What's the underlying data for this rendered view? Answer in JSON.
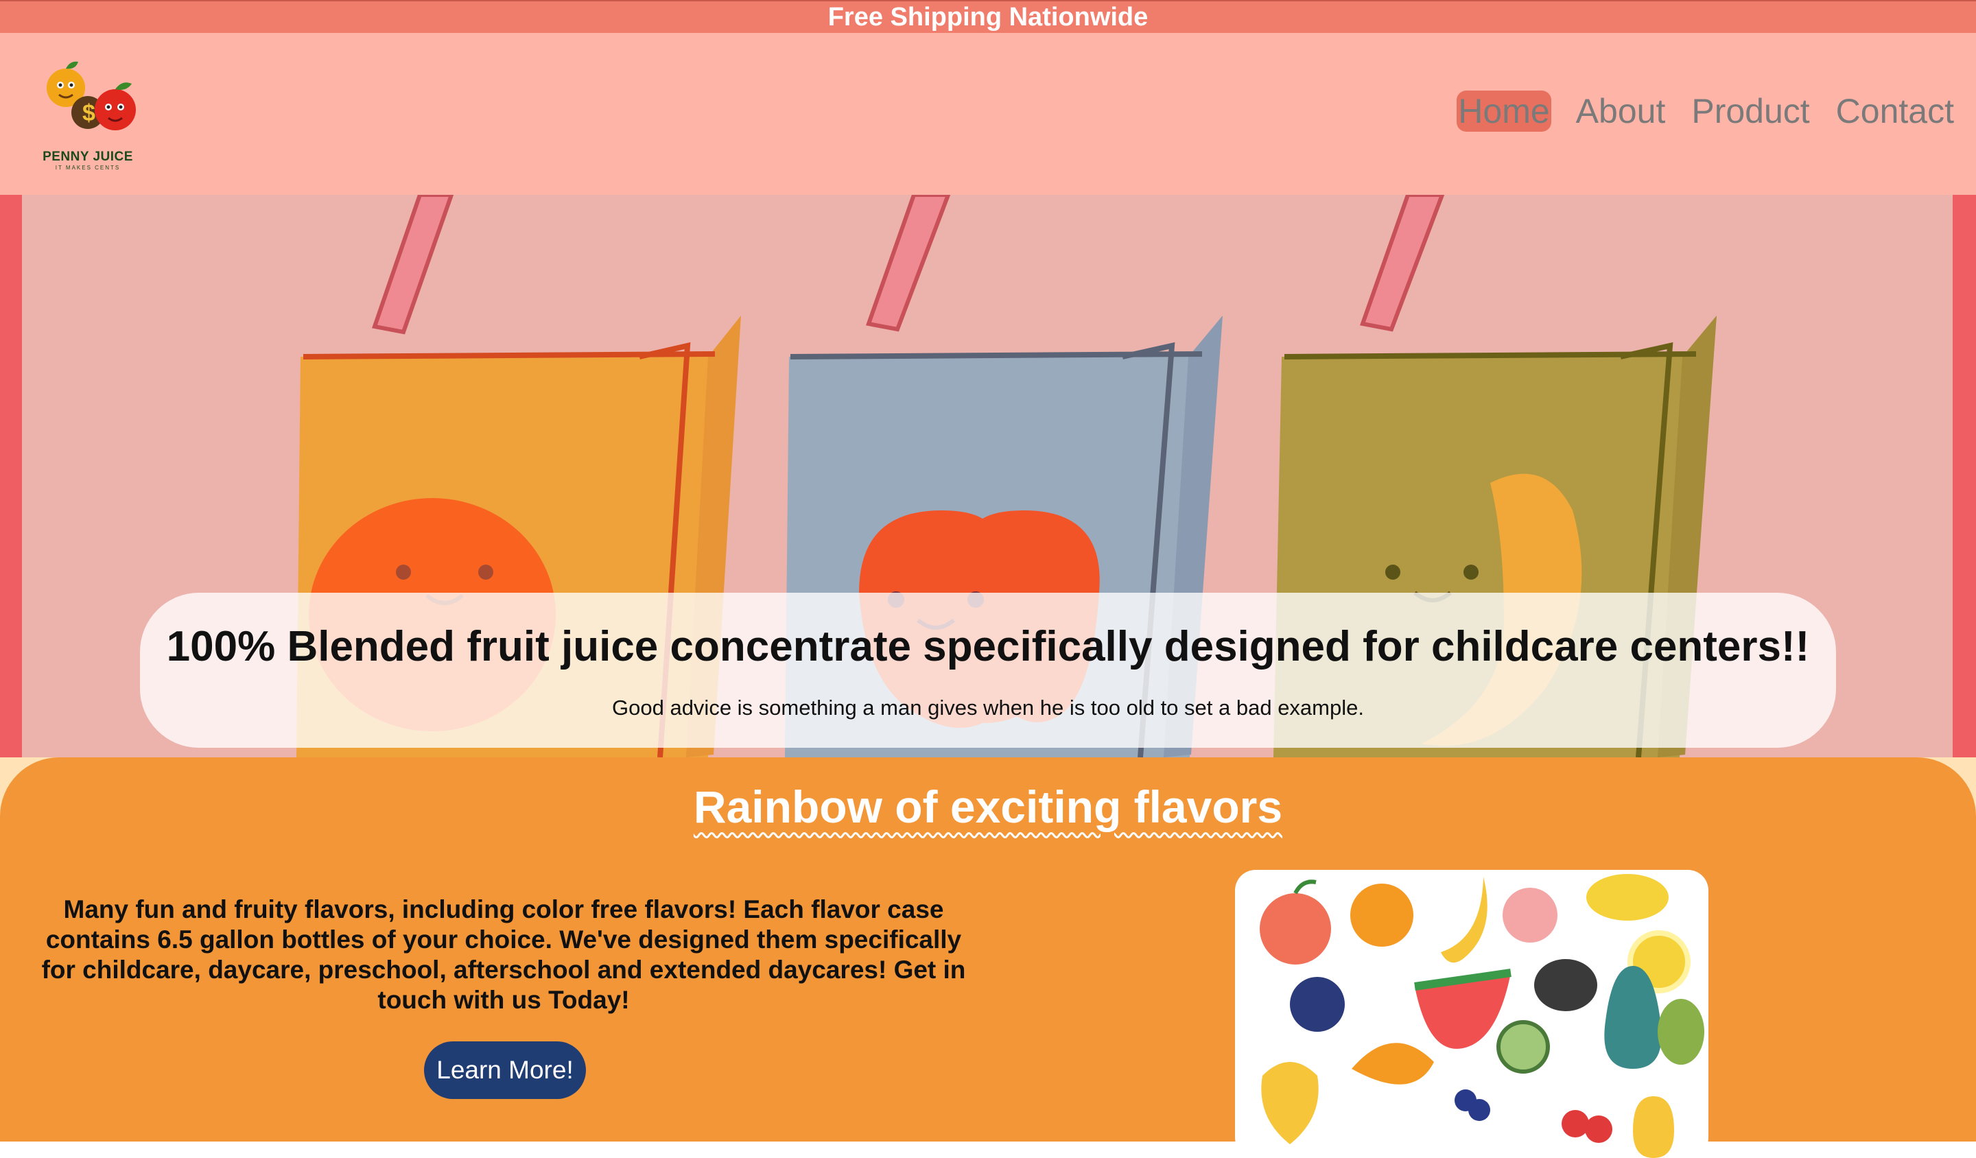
{
  "topbar": {
    "text": "Free Shipping Nationwide"
  },
  "brand": {
    "name": "PENNY JUICE",
    "tagline": "IT MAKES CENTS"
  },
  "nav": {
    "items": [
      {
        "label": "Home",
        "active": true
      },
      {
        "label": "About",
        "active": false
      },
      {
        "label": "Product",
        "active": false
      },
      {
        "label": "Contact",
        "active": false
      }
    ]
  },
  "hero": {
    "title": "100% Blended fruit juice concentrate specifically designed for childcare centers!!",
    "subtitle": "Good advice is something a man gives when he is too old to set a bad example."
  },
  "flavors": {
    "title": "Rainbow of exciting flavors",
    "body": "Many fun and fruity flavors, including color free flavors! Each flavor case contains 6.5 gallon bottles of your choice. We've designed them specifically for childcare, daycare, preschool, afterschool and extended daycares! Get in touch with us Today!",
    "button": "Learn More!"
  },
  "colors": {
    "topbar": "#f07c6c",
    "header": "#ffb4a8",
    "hero_bg": "#ecb2ac",
    "section": "#f29638",
    "button": "#1f3c73"
  }
}
